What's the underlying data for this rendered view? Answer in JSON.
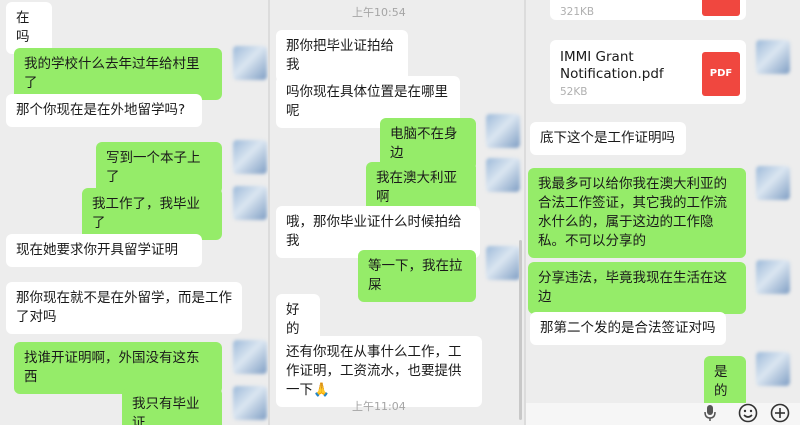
{
  "panel1": {
    "messages": [
      {
        "dir": "in",
        "text": "在吗"
      },
      {
        "dir": "out",
        "text": "我的学校什么去年过年给村里了"
      },
      {
        "dir": "in",
        "text": "那个你现在是在外地留学吗?"
      },
      {
        "dir": "out",
        "text": "写到一个本子上了"
      },
      {
        "dir": "out",
        "text": "我工作了，我毕业了"
      },
      {
        "dir": "in",
        "text": "现在她要求你开具留学证明"
      },
      {
        "dir": "in",
        "text": "那你现在就不是在外留学，而是工作了对吗"
      },
      {
        "dir": "out",
        "text": "找谁开证明啊，外国没有这东西"
      },
      {
        "dir": "out",
        "text": "我只有毕业证"
      }
    ]
  },
  "panel2": {
    "time_top": "上午10:54",
    "time_bottom": "上午11:04",
    "messages": [
      {
        "dir": "in",
        "text": "那你把毕业证拍给我"
      },
      {
        "dir": "in",
        "text": "吗你现在具体位置是在哪里呢"
      },
      {
        "dir": "out",
        "text": "电脑不在身边"
      },
      {
        "dir": "out",
        "text": "我在澳大利亚啊"
      },
      {
        "dir": "in",
        "text": "哦，那你毕业证什么时候拍给我"
      },
      {
        "dir": "out",
        "text": "等一下，我在拉屎"
      },
      {
        "dir": "in",
        "text": "好的"
      },
      {
        "dir": "in",
        "text": "还有你现在从事什么工作，工作证明，工资流水，也要提供一下🙏"
      }
    ]
  },
  "panel3": {
    "file_top": {
      "size": "321KB",
      "type": "PDF"
    },
    "file_main": {
      "name": "IMMI Grant Notification.pdf",
      "size": "52KB",
      "type": "PDF"
    },
    "messages": [
      {
        "dir": "in",
        "text": "底下这个是工作证明吗"
      },
      {
        "dir": "out",
        "text": "我最多可以给你我在澳大利亚的合法工作签证，其它我的工作流水什么的，属于这边的工作隐私。不可以分享的"
      },
      {
        "dir": "out",
        "text": "分享违法，毕竟我现在生活在这边"
      },
      {
        "dir": "in",
        "text": "那第二个发的是合法签证对吗"
      },
      {
        "dir": "out",
        "text": "是的"
      }
    ],
    "toolbar": {
      "mic_icon": "microphone-icon",
      "emoji_icon": "smiley-icon",
      "add_icon": "plus-circle-icon"
    }
  }
}
